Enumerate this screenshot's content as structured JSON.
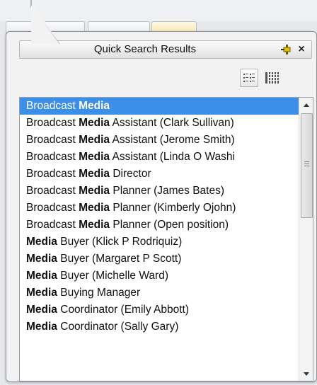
{
  "panel": {
    "title": "Quick Search Results",
    "close_glyph": "×",
    "highlight_term": "Media"
  },
  "results": [
    {
      "pre": "Broadcast ",
      "bold": "Media",
      "post": ""
    },
    {
      "pre": "Broadcast ",
      "bold": "Media",
      "post": " Assistant (Clark  Sullivan)"
    },
    {
      "pre": "Broadcast ",
      "bold": "Media",
      "post": " Assistant (Jerome  Smith)"
    },
    {
      "pre": "Broadcast ",
      "bold": "Media",
      "post": " Assistant (Linda O Washi"
    },
    {
      "pre": "Broadcast ",
      "bold": "Media",
      "post": " Director"
    },
    {
      "pre": "Broadcast ",
      "bold": "Media",
      "post": " Planner (James  Bates)"
    },
    {
      "pre": "Broadcast ",
      "bold": "Media",
      "post": " Planner (Kimberly  Ojohn)"
    },
    {
      "pre": "Broadcast ",
      "bold": "Media",
      "post": " Planner (Open position)"
    },
    {
      "pre": "",
      "bold": "Media",
      "post": " Buyer (Klick P Rodriquiz)"
    },
    {
      "pre": "",
      "bold": "Media",
      "post": " Buyer (Margaret P Scott)"
    },
    {
      "pre": "",
      "bold": "Media",
      "post": " Buyer (Michelle  Ward)"
    },
    {
      "pre": "",
      "bold": "Media",
      "post": " Buying Manager"
    },
    {
      "pre": "",
      "bold": "Media",
      "post": " Coordinator (Emily  Abbott)"
    },
    {
      "pre": "",
      "bold": "Media",
      "post": " Coordinator (Sally  Gary)"
    }
  ],
  "selected_index": 0,
  "colors": {
    "selection": "#3d8ee6",
    "pin": "#c9a800"
  },
  "icons": {
    "pin": "pin-icon",
    "close": "close-icon",
    "list_view": "list-view-icon",
    "grid_view": "grid-view-icon",
    "scroll_up": "scroll-up-icon",
    "scroll_down": "scroll-down-icon"
  }
}
